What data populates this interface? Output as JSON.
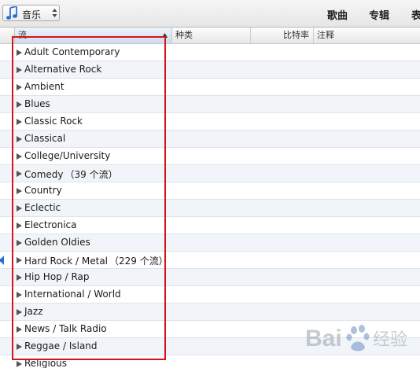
{
  "toolbar": {
    "library_label": "音乐",
    "library_icon": "music-note-icon",
    "tabs": [
      {
        "label": "歌曲"
      },
      {
        "label": "专辑"
      },
      {
        "label": "表"
      }
    ]
  },
  "columns": {
    "stream": "流",
    "type": "种类",
    "bitrate": "比特率",
    "comment": "注释"
  },
  "rows": [
    {
      "label": "Adult Contemporary",
      "count": ""
    },
    {
      "label": "Alternative Rock",
      "count": ""
    },
    {
      "label": "Ambient",
      "count": ""
    },
    {
      "label": "Blues",
      "count": ""
    },
    {
      "label": "Classic Rock",
      "count": ""
    },
    {
      "label": "Classical",
      "count": ""
    },
    {
      "label": "College/University",
      "count": ""
    },
    {
      "label": "Comedy",
      "count": "（39 个流）"
    },
    {
      "label": "Country",
      "count": ""
    },
    {
      "label": "Eclectic",
      "count": ""
    },
    {
      "label": "Electronica",
      "count": ""
    },
    {
      "label": "Golden Oldies",
      "count": ""
    },
    {
      "label": "Hard Rock / Metal",
      "count": "（229 个流）"
    },
    {
      "label": "Hip Hop / Rap",
      "count": ""
    },
    {
      "label": "International / World",
      "count": ""
    },
    {
      "label": "Jazz",
      "count": ""
    },
    {
      "label": "News / Talk Radio",
      "count": ""
    },
    {
      "label": "Reggae / Island",
      "count": ""
    },
    {
      "label": "Religious",
      "count": ""
    }
  ],
  "playing_indicator_row": "Hard Rock / Metal",
  "colors": {
    "highlight": "#d4141c",
    "alt_row": "#f1f5fa",
    "accent_blue": "#2a6fd6"
  },
  "watermark": {
    "text": "Bai 经验"
  }
}
